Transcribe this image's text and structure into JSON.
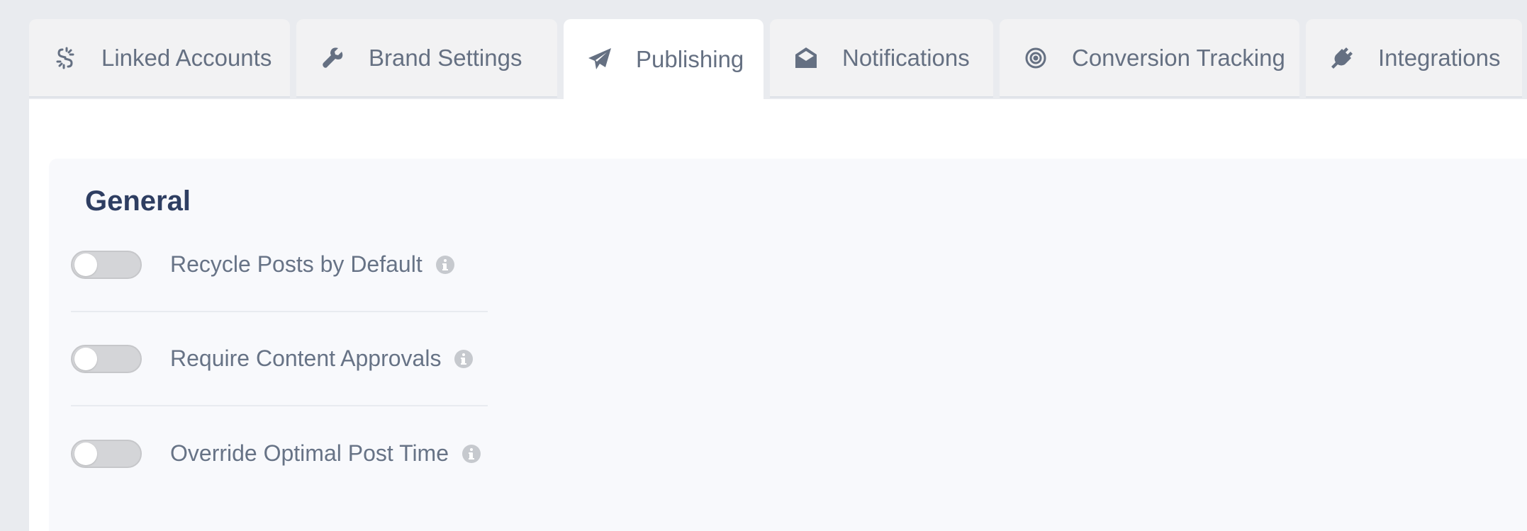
{
  "tabs": [
    {
      "label": "Linked Accounts",
      "icon": "link-broken-icon",
      "active": false
    },
    {
      "label": "Brand Settings",
      "icon": "wrench-icon",
      "active": false
    },
    {
      "label": "Publishing",
      "icon": "paper-plane-icon",
      "active": true
    },
    {
      "label": "Notifications",
      "icon": "envelope-open-icon",
      "active": false
    },
    {
      "label": "Conversion Tracking",
      "icon": "bullseye-icon",
      "active": false
    },
    {
      "label": "Integrations",
      "icon": "plug-icon",
      "active": false
    }
  ],
  "section": {
    "title": "General",
    "settings": [
      {
        "label": "Recycle Posts by Default",
        "enabled": false,
        "info_icon": "info-icon"
      },
      {
        "label": "Require Content Approvals",
        "enabled": false,
        "info_icon": "info-icon"
      },
      {
        "label": "Override Optimal Post Time",
        "enabled": false,
        "info_icon": "info-icon"
      }
    ]
  },
  "colors": {
    "page_bg": "#e9ebef",
    "tab_bg": "#f2f2f3",
    "text": "#657082",
    "title": "#2e3e62",
    "toggle_off": "#d4d5d8"
  }
}
